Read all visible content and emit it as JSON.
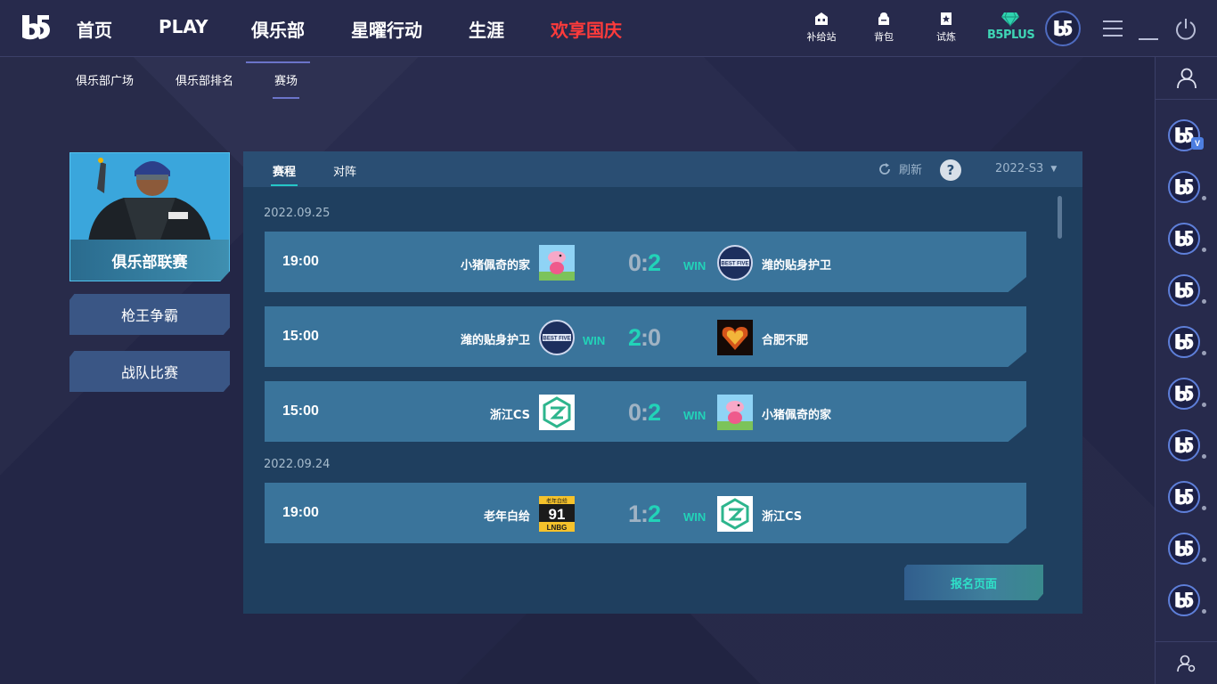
{
  "topnav": {
    "items": [
      "首页",
      "PLAY",
      "俱乐部",
      "星曜行动",
      "生涯",
      "欢享国庆"
    ],
    "active": "俱乐部",
    "icons": [
      {
        "name": "supply-station-icon",
        "label": "补给站"
      },
      {
        "name": "backpack-icon",
        "label": "背包"
      },
      {
        "name": "trial-icon",
        "label": "试炼"
      }
    ],
    "plus_label": "B5PLUS"
  },
  "subnav": {
    "items": [
      "俱乐部广场",
      "俱乐部排名",
      "赛场"
    ],
    "active": "赛场"
  },
  "left_menu": {
    "featured": "俱乐部联赛",
    "items": [
      "枪王争霸",
      "战队比赛"
    ]
  },
  "panel": {
    "tabs": [
      "赛程",
      "对阵"
    ],
    "active_tab": "赛程",
    "refresh_label": "刷新",
    "help_label": "?",
    "season": "2022-S3",
    "signup_label": "报名页面",
    "win_label": "WIN",
    "groups": [
      {
        "date": "2022.09.25",
        "matches": [
          {
            "time": "19:00",
            "left": "小猪佩奇的家",
            "left_logo": "peppa-logo",
            "score_left": "0",
            "score_right": "2",
            "right": "潍的贴身护卫",
            "right_logo": "bestfive-logo",
            "winner": "right"
          },
          {
            "time": "15:00",
            "left": "潍的贴身护卫",
            "left_logo": "bestfive-logo",
            "score_left": "2",
            "score_right": "0",
            "right": "合肥不肥",
            "right_logo": "heart-logo",
            "winner": "left"
          },
          {
            "time": "15:00",
            "left": "浙江CS",
            "left_logo": "zhejiang-logo",
            "score_left": "0",
            "score_right": "2",
            "right": "小猪佩奇的家",
            "right_logo": "peppa-logo",
            "winner": "right"
          }
        ]
      },
      {
        "date": "2022.09.24",
        "matches": [
          {
            "time": "19:00",
            "left": "老年白给",
            "left_logo": "lnbg-logo",
            "score_left": "1",
            "score_right": "2",
            "right": "浙江CS",
            "right_logo": "zhejiang-logo",
            "winner": "right"
          }
        ]
      }
    ],
    "logo_texts": {
      "lnbg_top": "老年白给",
      "lnbg_num": "91",
      "lnbg_bottom": "LNBG",
      "bestfive": "BEST FIVE"
    }
  },
  "colors": {
    "accent": "#22d3b8",
    "festival": "#ff3b3b",
    "panel": "#1f3f5f",
    "row": "#3a749b"
  }
}
